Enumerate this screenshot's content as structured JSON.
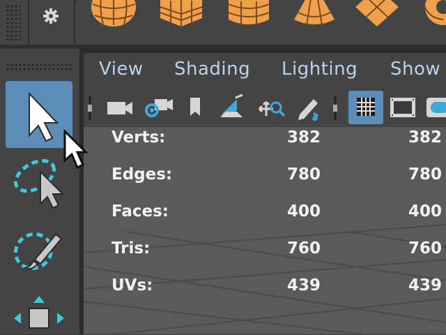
{
  "panel": {
    "menus": [
      "View",
      "Shading",
      "Lighting",
      "Show"
    ]
  },
  "hud": {
    "rows": [
      {
        "label": "Verts:",
        "value1": "382",
        "value2": "382"
      },
      {
        "label": "Edges:",
        "value1": "780",
        "value2": "780"
      },
      {
        "label": "Faces:",
        "value1": "400",
        "value2": "400"
      },
      {
        "label": "Tris:",
        "value1": "760",
        "value2": "760"
      },
      {
        "label": "UVs:",
        "value1": "439",
        "value2": "439"
      }
    ]
  },
  "colors": {
    "accent_blue": "#5b8db8",
    "shelf_orange": "#f0a04b",
    "menu_text": "#bcd3ec",
    "lasso_cyan": "#3fc8d8"
  },
  "icons": {
    "shelf": [
      "settings-gear-icon",
      "poly-sphere-icon",
      "poly-cube-icon",
      "poly-cylinder-icon",
      "poly-cone-icon",
      "poly-plane-icon",
      "poly-torus-icon"
    ],
    "toolbox": [
      "select-tool-icon",
      "lasso-tool-icon",
      "paint-select-tool-icon",
      "move-tool-icon"
    ],
    "panel_toolbar": [
      "camera-icon",
      "camera-attributes-icon",
      "bookmark-icon",
      "image-plane-icon",
      "two-d-pan-zoom-icon",
      "grease-pencil-icon",
      "grid-icon",
      "film-gate-icon",
      "resolution-gate-icon"
    ]
  }
}
